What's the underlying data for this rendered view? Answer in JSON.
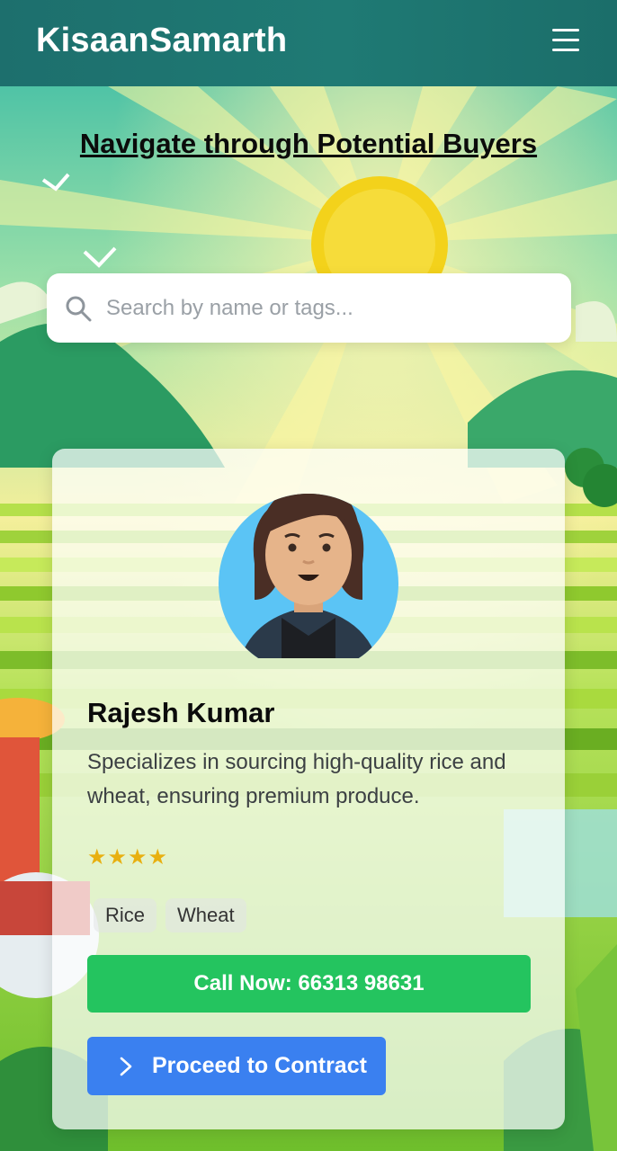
{
  "app": {
    "title": "KisaanSamarth"
  },
  "header": {
    "menu_icon": "hamburger-menu-icon"
  },
  "page": {
    "heading": "Navigate through Potential Buyers"
  },
  "search": {
    "placeholder": "Search by name or tags...",
    "value": "",
    "icon": "search-icon"
  },
  "buyer": {
    "name": "Rajesh Kumar",
    "description": "Specializes in sourcing high-quality rice and wheat, ensuring premium produce.",
    "rating_stars": "★★★★",
    "rating_value": 4,
    "tags": [
      "Rice",
      "Wheat"
    ],
    "call_label": "Call Now: 66313 98631",
    "contract_label": "Proceed to Contract",
    "contract_icon": "chevron-right-icon"
  },
  "colors": {
    "header": "#1f7a74",
    "call_button": "#24c45f",
    "contract_button": "#3a80f0",
    "star": "#e8b010"
  }
}
